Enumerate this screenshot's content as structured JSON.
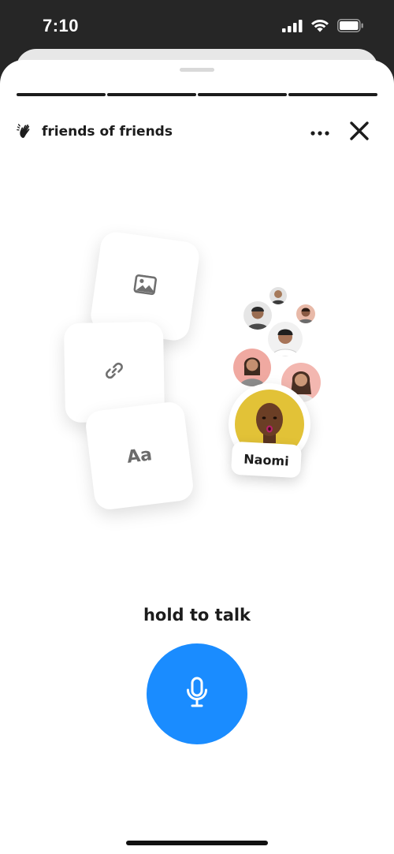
{
  "status_bar": {
    "time": "7:10",
    "icons": [
      "signal-icon",
      "wifi-icon",
      "battery-icon"
    ]
  },
  "header": {
    "icon": "waving-hand-icon",
    "title": "friends of friends",
    "more_icon": "more-horizontal-icon",
    "close_icon": "close-icon"
  },
  "progress": {
    "segments": 4,
    "filled": 4
  },
  "cards": [
    {
      "type": "image",
      "icon": "image-icon"
    },
    {
      "type": "link",
      "icon": "link-icon"
    },
    {
      "type": "text",
      "glyph": "Aa"
    }
  ],
  "featured_person": {
    "name": "Naomi"
  },
  "talk": {
    "label": "hold to talk",
    "button_icon": "microphone-icon",
    "color": "#1a8cff"
  }
}
